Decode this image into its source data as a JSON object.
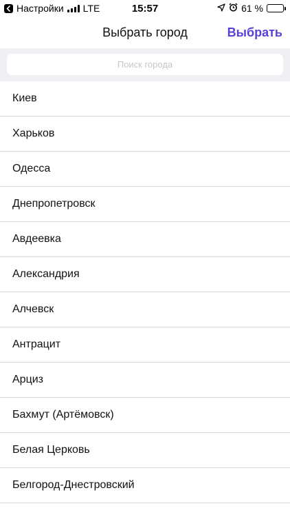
{
  "status_bar": {
    "back_app": "Настройки",
    "network": "LTE",
    "time": "15:57",
    "battery_percent": "61 %",
    "battery_level": 0.61
  },
  "nav": {
    "title": "Выбрать город",
    "action_label": "Выбрать"
  },
  "search": {
    "placeholder": "Поиск города",
    "value": ""
  },
  "cities": [
    "Киев",
    "Харьков",
    "Одесса",
    "Днепропетровск",
    "Авдеевка",
    "Александрия",
    "Алчевск",
    "Антрацит",
    "Арциз",
    "Бахмут (Артёмовск)",
    "Белая Церковь",
    "Белгород-Днестровский"
  ],
  "colors": {
    "accent": "#5b3fd6",
    "search_bg": "#efeff4",
    "separator": "#d8d8dc"
  },
  "icons": [
    "back-chevron-icon",
    "signal-bars-icon",
    "location-arrow-icon",
    "alarm-icon",
    "battery-icon"
  ]
}
